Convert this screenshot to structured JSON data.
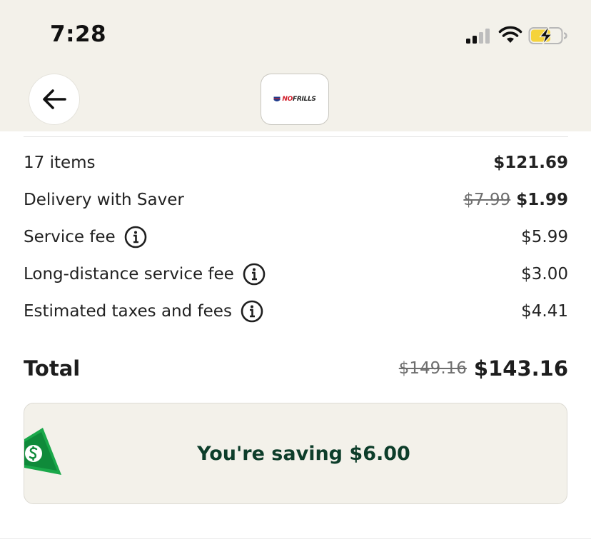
{
  "status_bar": {
    "time": "7:28",
    "icons": [
      "signal-icon",
      "wifi-icon",
      "battery-charging-icon"
    ],
    "battery_color": "#f5d33b"
  },
  "header": {
    "back_icon": "arrow-left-icon",
    "store_logo": {
      "no": "NO",
      "frills": "FRILLS",
      "mark": "shield-icon"
    }
  },
  "summary": {
    "items": {
      "label": "17 items",
      "value": "$121.69"
    },
    "delivery": {
      "label": "Delivery with Saver",
      "old_value": "$7.99",
      "value": "$1.99"
    },
    "service_fee": {
      "label": "Service fee",
      "value": "$5.99"
    },
    "long_distance": {
      "label": "Long-distance service fee",
      "value": "$3.00"
    },
    "taxes": {
      "label": "Estimated taxes and fees",
      "value": "$4.41"
    }
  },
  "total": {
    "label": "Total",
    "old_value": "$149.16",
    "value": "$143.16"
  },
  "savings": {
    "text": "You're saving $6.00",
    "icon": "cash-icon",
    "accent": "#1aa84a",
    "text_color": "#0d3d2a"
  }
}
